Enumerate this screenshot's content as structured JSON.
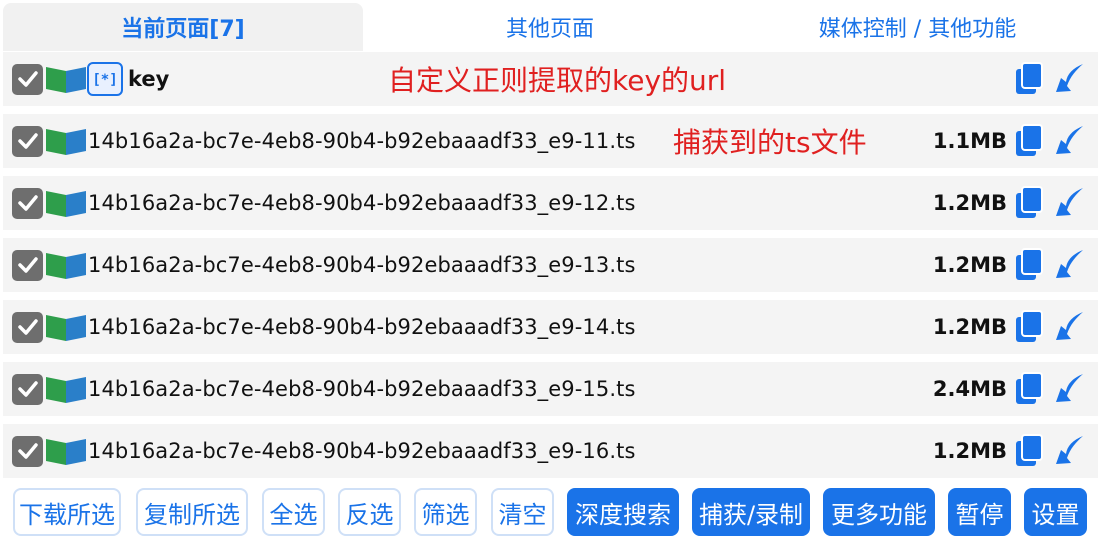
{
  "tabs": {
    "current": "当前页面[7]",
    "other": "其他页面",
    "media": "媒体控制 / 其他功能"
  },
  "key_row": {
    "name": "key",
    "annotation": "自定义正则提取的key的url"
  },
  "ts_annotation": "捕获到的ts文件",
  "files": [
    {
      "name": "14b16a2a-bc7e-4eb8-90b4-b92ebaaadf33_e9-11.ts",
      "size": "1.1MB"
    },
    {
      "name": "14b16a2a-bc7e-4eb8-90b4-b92ebaaadf33_e9-12.ts",
      "size": "1.2MB"
    },
    {
      "name": "14b16a2a-bc7e-4eb8-90b4-b92ebaaadf33_e9-13.ts",
      "size": "1.2MB"
    },
    {
      "name": "14b16a2a-bc7e-4eb8-90b4-b92ebaaadf33_e9-14.ts",
      "size": "1.2MB"
    },
    {
      "name": "14b16a2a-bc7e-4eb8-90b4-b92ebaaadf33_e9-15.ts",
      "size": "2.4MB"
    },
    {
      "name": "14b16a2a-bc7e-4eb8-90b4-b92ebaaadf33_e9-16.ts",
      "size": "1.2MB"
    }
  ],
  "buttons": {
    "download_selected": "下载所选",
    "copy_selected": "复制所选",
    "select_all": "全选",
    "invert": "反选",
    "filter": "筛选",
    "clear": "清空",
    "deep_search": "深度搜索",
    "capture_record": "捕获/录制",
    "more": "更多功能",
    "pause": "暂停",
    "settings": "设置"
  },
  "colors": {
    "accent": "#1a73e8",
    "annotation": "#e02020",
    "row_bg": "#f4f4f4",
    "checkbox": "#6e6e6e"
  },
  "icons": {
    "checkbox": "checkbox-checked-icon",
    "type": "ts-file-type-icon",
    "key": "regex-key-icon",
    "copy": "copy-icon",
    "download": "download-arrow-icon"
  }
}
